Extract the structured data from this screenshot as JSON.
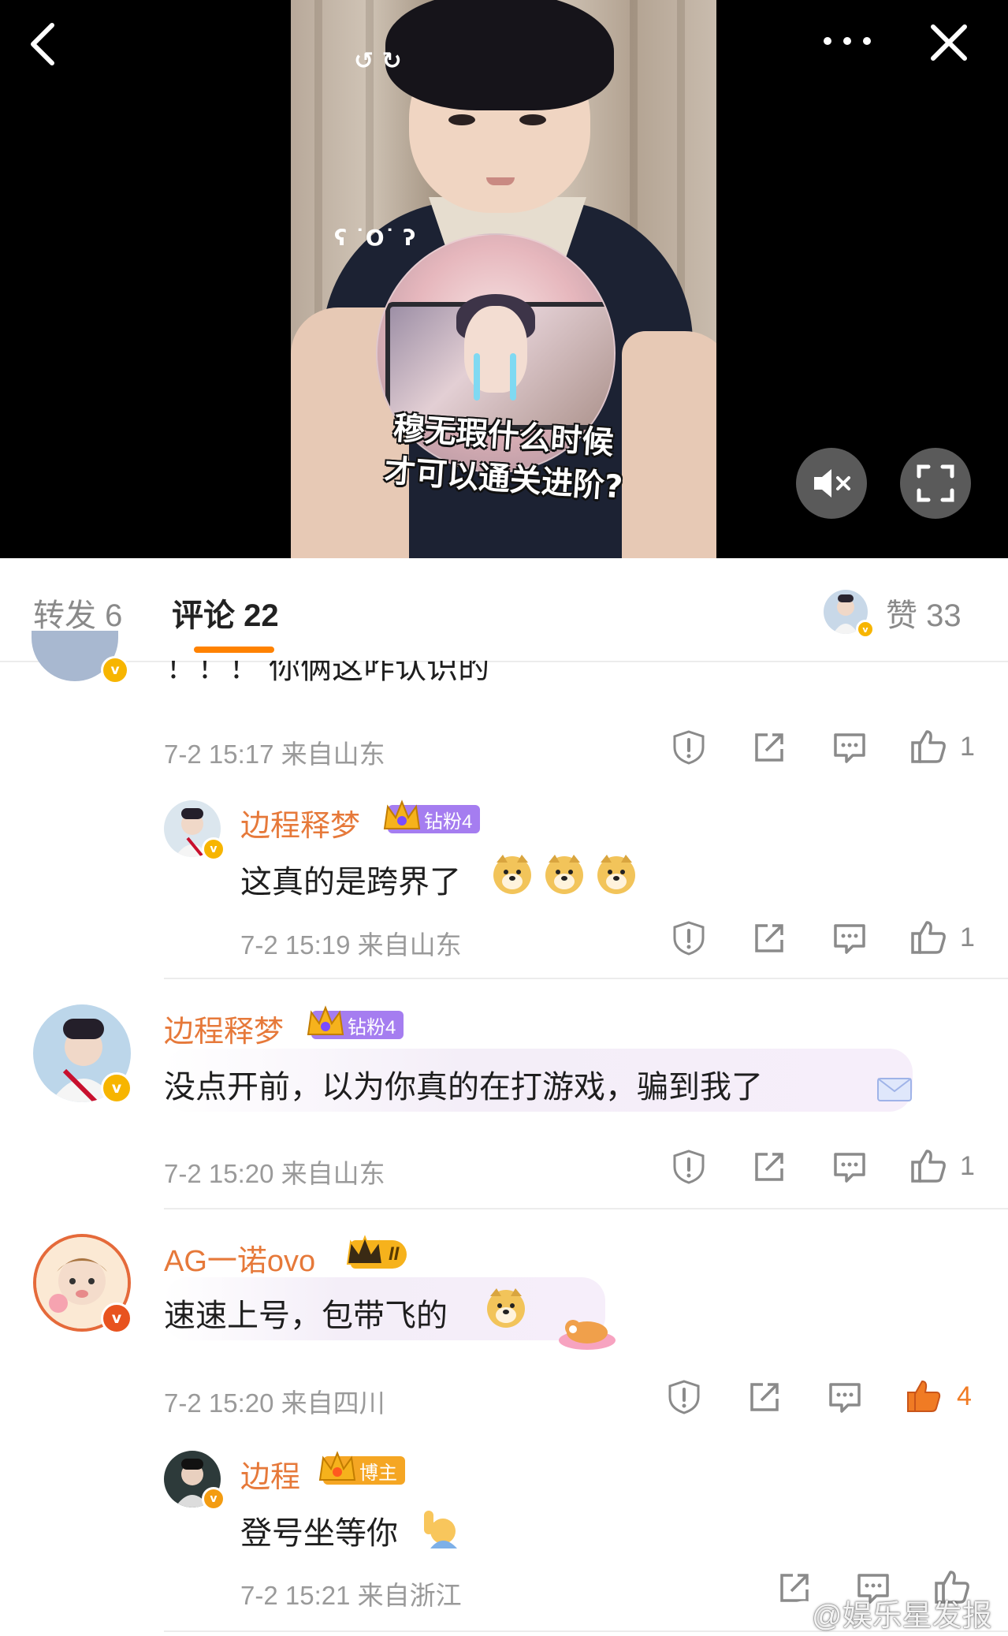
{
  "video": {
    "caption_line1": "穆无瑕什么时候",
    "caption_line2": "才可以通关进阶?",
    "doodle_face": "ʕ ˙O˙ ʔ",
    "doodle_marks": "↺ ↻"
  },
  "topbar": {
    "back_icon": "chevron-left-icon",
    "more_icon": "more-dots-icon",
    "close_icon": "close-icon"
  },
  "controls": {
    "mute_icon": "mute-icon",
    "fullscreen_icon": "fullscreen-icon"
  },
  "tabs": {
    "repost": "转发 6",
    "comments": "评论 22",
    "likes": "赞 33"
  },
  "comments": [
    {
      "id": "c0",
      "partial_text": "！！！ 你俩这咋认识的",
      "meta": "7-2 15:17 来自山东",
      "likes": "1"
    },
    {
      "id": "c1",
      "name": "边程释梦",
      "badge": "钻粉4",
      "text": "这真的是跨界了",
      "meta": "7-2 15:19 来自山东",
      "likes": "1"
    },
    {
      "id": "c2",
      "name": "边程释梦",
      "badge": "钻粉4",
      "text": "没点开前，以为你真的在打游戏，骗到我了",
      "meta": "7-2 15:20 来自山东",
      "likes": "1"
    },
    {
      "id": "c3",
      "name": "AG一诺ovo",
      "badge": "II",
      "text": "速速上号，包带飞的",
      "meta": "7-2 15:20 来自四川",
      "likes": "4"
    },
    {
      "id": "c4",
      "name": "边程",
      "badge": "博主",
      "text": "登号坐等你",
      "meta": "7-2 15:21 来自浙江"
    }
  ],
  "watermark": "@娱乐星发报",
  "colors": {
    "accent": "#ff8200",
    "name": "#e6793a",
    "liked": "#f07b24",
    "badge_fan": "#a57df0",
    "badge_host": "#f5a623",
    "vip": "#f7b500"
  }
}
